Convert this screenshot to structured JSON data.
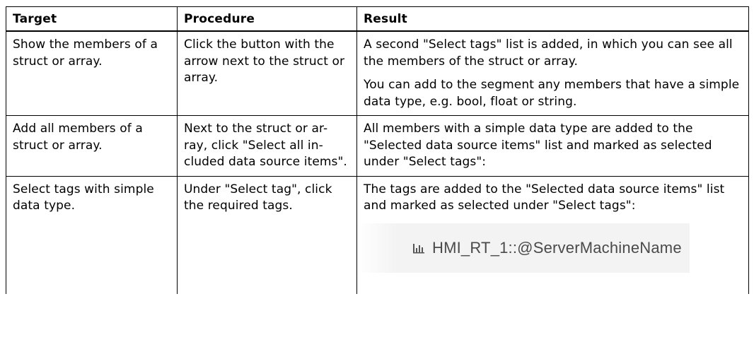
{
  "table": {
    "headers": [
      "Target",
      "Procedure",
      "Result"
    ],
    "rows": [
      {
        "target": "Show the members of a struct or array.",
        "procedure": "Click the button with the arrow next to the struct or array.",
        "result_p1": "A second \"Select tags\" list is added, in which you can see all the members of the struct or array.",
        "result_p2": "You can add to the segment any members that have a simple data type, e.g. bool, float or string."
      },
      {
        "target": "Add all members of a struct or array.",
        "procedure": "Next to the struct or ar-ray, click \"Select all in-cluded data source items\".",
        "result_p1": "All members with a simple data type are added to the \"Selected data source items\" list and marked as selected under \"Select tags\":"
      },
      {
        "target": "Select tags with simple data type.",
        "procedure": "Under \"Select tag\", click the required tags.",
        "result_p1": "The tags are added to the \"Selected data source items\" list and marked as selected under \"Select tags\":",
        "tag_icon": "chart-tag-icon",
        "tag_label": "HMI_RT_1::@ServerMachineName"
      }
    ]
  }
}
